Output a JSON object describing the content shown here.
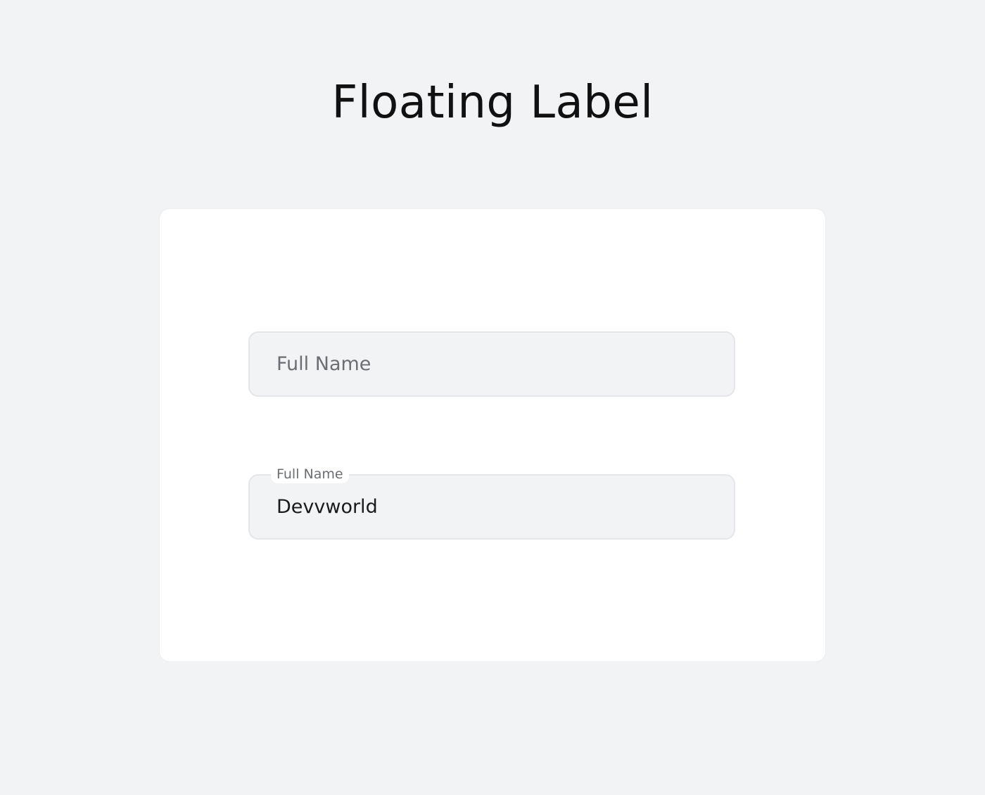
{
  "page": {
    "title": "Floating Label"
  },
  "form": {
    "empty_field": {
      "placeholder": "Full Name",
      "value": ""
    },
    "filled_field": {
      "label": "Full Name",
      "value": "Devvworld"
    }
  },
  "colors": {
    "background": "#f2f3f5",
    "card": "#ffffff",
    "input_fill": "#f2f3f5",
    "input_border": "#e4e6ea",
    "text_primary": "#111111",
    "text_muted": "#6b6e73"
  }
}
